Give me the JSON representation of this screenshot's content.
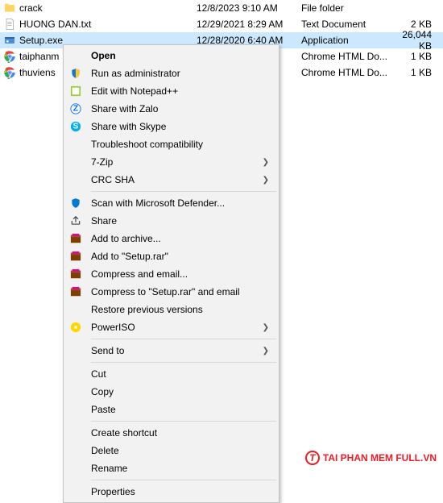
{
  "files": [
    {
      "icon": "folder",
      "name": "crack",
      "date": "12/8/2023 9:10 AM",
      "type": "File folder",
      "size": ""
    },
    {
      "icon": "txt",
      "name": "HUONG DAN.txt",
      "date": "12/29/2021 8:29 AM",
      "type": "Text Document",
      "size": "2 KB"
    },
    {
      "icon": "exe",
      "name": "Setup.exe",
      "date": "12/28/2020 6:40 AM",
      "type": "Application",
      "size": "26,044 KB",
      "selected": true
    },
    {
      "icon": "chrome",
      "name": "taiphanm",
      "date": "",
      "type": "Chrome HTML Do...",
      "size": "1 KB"
    },
    {
      "icon": "chrome",
      "name": "thuviens",
      "date": "",
      "type": "Chrome HTML Do...",
      "size": "1 KB"
    }
  ],
  "menu": {
    "open": "Open",
    "run_admin": "Run as administrator",
    "edit_npp": "Edit with Notepad++",
    "share_zalo": "Share with Zalo",
    "share_skype": "Share with Skype",
    "troubleshoot": "Troubleshoot compatibility",
    "sevenzip": "7-Zip",
    "crcsha": "CRC SHA",
    "defender": "Scan with Microsoft Defender...",
    "share": "Share",
    "add_archive": "Add to archive...",
    "add_rar": "Add to \"Setup.rar\"",
    "compress_email": "Compress and email...",
    "compress_rar_email": "Compress to \"Setup.rar\" and email",
    "restore": "Restore previous versions",
    "poweriso": "PowerISO",
    "sendto": "Send to",
    "cut": "Cut",
    "copy": "Copy",
    "paste": "Paste",
    "shortcut": "Create shortcut",
    "delete": "Delete",
    "rename": "Rename",
    "properties": "Properties"
  },
  "watermark": {
    "text": "TAI PHAN MEM FULL.VN",
    "glyph": "T"
  }
}
